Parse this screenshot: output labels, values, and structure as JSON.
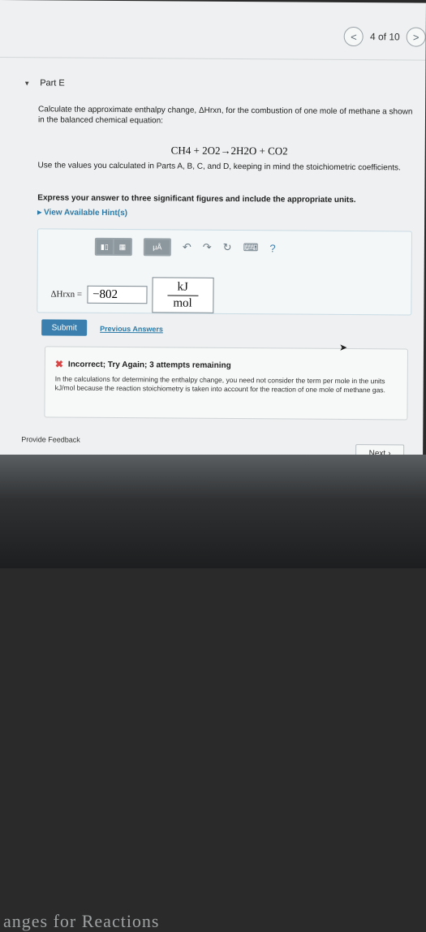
{
  "nav": {
    "prev_icon": "<",
    "next_icon": ">",
    "page_count": "4 of 10"
  },
  "part": {
    "title": "Part E"
  },
  "question": {
    "text": "Calculate the approximate enthalpy change, ΔHrxn, for the combustion of one mole of methane a shown in the balanced chemical equation:",
    "equation": "CH4 + 2O2→2H2O + CO2",
    "text2": "Use the values you calculated in Parts A, B, C, and D, keeping in mind the stoichiometric coefficients.",
    "express": "Express your answer to three significant figures and include the appropriate units.",
    "hints": "View Available Hint(s)"
  },
  "answer": {
    "label": "ΔHrxn =",
    "value": "−802",
    "unit_num": "kJ",
    "unit_den": "mol",
    "toolbar": {
      "unit_btn": "μÅ",
      "help": "?"
    }
  },
  "actions": {
    "submit": "Submit",
    "previous_answers": "Previous Answers"
  },
  "feedback": {
    "title": "Incorrect; Try Again; 3 attempts remaining",
    "body": "In the calculations for determining the enthalpy change, you need not consider the term per mole in the units kJ/mol because the reaction stoichiometry is taken into account for the reaction of one mole of methane gas."
  },
  "footer": {
    "provide_feedback": "Provide Feedback",
    "next": "Next"
  },
  "background_text": "anges for Reactions"
}
